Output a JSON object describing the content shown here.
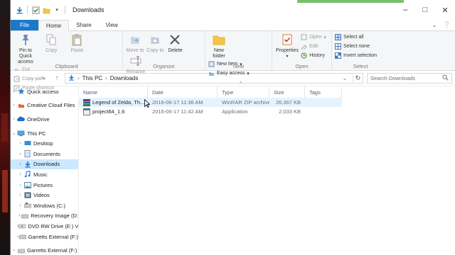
{
  "window": {
    "title": "Downloads"
  },
  "ribbon": {
    "tabs": [
      "File",
      "Home",
      "Share",
      "View"
    ],
    "active_tab": "Home",
    "clipboard": {
      "label": "Clipboard",
      "pin": "Pin to Quick access",
      "copy": "Copy",
      "paste": "Paste",
      "cut": "Cut",
      "copy_path": "Copy path",
      "paste_shortcut": "Paste shortcut"
    },
    "organize": {
      "label": "Organize",
      "move_to": "Move to",
      "copy_to": "Copy to",
      "delete": "Delete",
      "rename": "Rename"
    },
    "new": {
      "label": "New",
      "new_folder": "New folder",
      "new_item": "New item",
      "easy_access": "Easy access"
    },
    "open": {
      "label": "Open",
      "properties": "Properties",
      "open": "Open",
      "edit": "Edit",
      "history": "History"
    },
    "select": {
      "label": "Select",
      "select_all": "Select all",
      "select_none": "Select none",
      "invert_selection": "Invert selection"
    }
  },
  "address": {
    "crumbs": [
      "This PC",
      "Downloads"
    ],
    "search_placeholder": "Search Downloads"
  },
  "nav": {
    "items": [
      {
        "label": "Quick access",
        "icon": "star-icon"
      },
      {
        "label": "Creative Cloud Files",
        "icon": "cloud-icon"
      },
      {
        "label": "OneDrive",
        "icon": "onedrive-icon"
      },
      {
        "label": "This PC",
        "icon": "computer-icon"
      },
      {
        "label": "Desktop",
        "icon": "desktop-icon"
      },
      {
        "label": "Documents",
        "icon": "documents-icon"
      },
      {
        "label": "Downloads",
        "icon": "downloads-icon"
      },
      {
        "label": "Music",
        "icon": "music-icon"
      },
      {
        "label": "Pictures",
        "icon": "pictures-icon"
      },
      {
        "label": "Videos",
        "icon": "videos-icon"
      },
      {
        "label": "Windows (C:)",
        "icon": "drive-icon"
      },
      {
        "label": "Recovery Image (D:",
        "icon": "drive-icon"
      },
      {
        "label": "DVD RW Drive (E:) V",
        "icon": "dvd-icon"
      },
      {
        "label": "Garretts External (F:)",
        "icon": "drive-icon"
      },
      {
        "label": "Garretts External (F:)",
        "icon": "drive-icon"
      }
    ]
  },
  "files": {
    "columns": [
      "Name",
      "Date",
      "Type",
      "Size",
      "Tags"
    ],
    "rows": [
      {
        "name": "Legend of Zelda, Th...",
        "date": "2016-06-17 11:36 AM",
        "type": "WinRAR ZIP archive",
        "size": "26,367 KB",
        "icon": "zip-archive-icon"
      },
      {
        "name": "project64_1.6",
        "date": "2016-06-17 11:42 AM",
        "type": "Application",
        "size": "2,033 KB",
        "icon": "application-icon"
      }
    ]
  }
}
